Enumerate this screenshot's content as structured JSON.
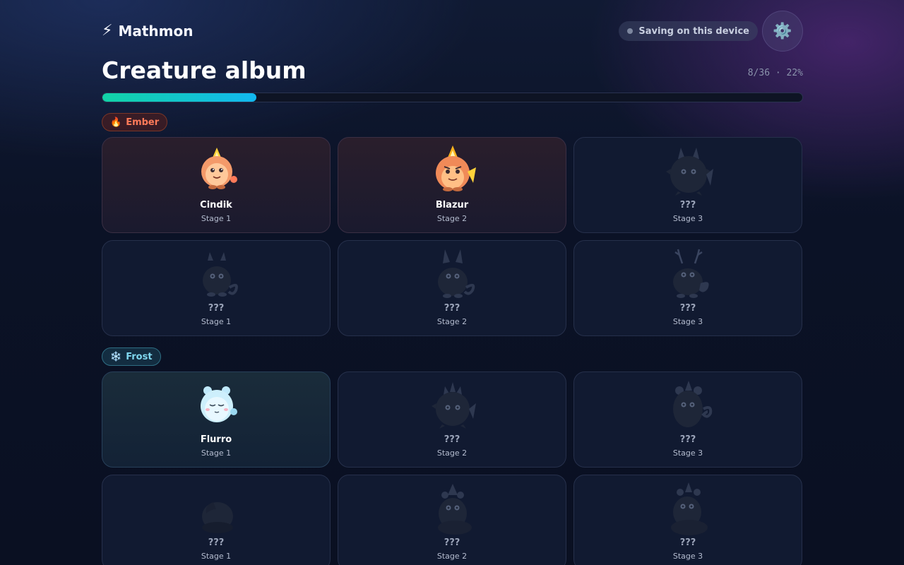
{
  "app": {
    "title": "Mathmon",
    "icon": "lightning-icon"
  },
  "save_status": "Saving on this device",
  "settings_icon": "gear-icon",
  "page_title": "Creature album",
  "progress": {
    "text": "8/36 · 22%",
    "fraction": 0.22
  },
  "colors": {
    "progress_start": "#12d3a6",
    "progress_end": "#12b8f0",
    "ember": "#ff7a59",
    "frost": "#7fd7ef"
  },
  "sections": [
    {
      "label": "Ember",
      "icon": "🔥",
      "cards": [
        {
          "name": "Cindik",
          "stage": "Stage 1",
          "owned": true
        },
        {
          "name": "Blazur",
          "stage": "Stage 2",
          "owned": true
        },
        {
          "name": "???",
          "stage": "Stage 3",
          "owned": false
        },
        {
          "name": "???",
          "stage": "Stage 1",
          "owned": false
        },
        {
          "name": "???",
          "stage": "Stage 2",
          "owned": false
        },
        {
          "name": "???",
          "stage": "Stage 3",
          "owned": false
        }
      ]
    },
    {
      "label": "Frost",
      "icon": "❄️",
      "cards": [
        {
          "name": "Flurro",
          "stage": "Stage 1",
          "owned": true
        },
        {
          "name": "???",
          "stage": "Stage 2",
          "owned": false
        },
        {
          "name": "???",
          "stage": "Stage 3",
          "owned": false
        },
        {
          "name": "???",
          "stage": "Stage 1",
          "owned": false
        },
        {
          "name": "???",
          "stage": "Stage 2",
          "owned": false
        },
        {
          "name": "???",
          "stage": "Stage 3",
          "owned": false
        }
      ]
    }
  ]
}
